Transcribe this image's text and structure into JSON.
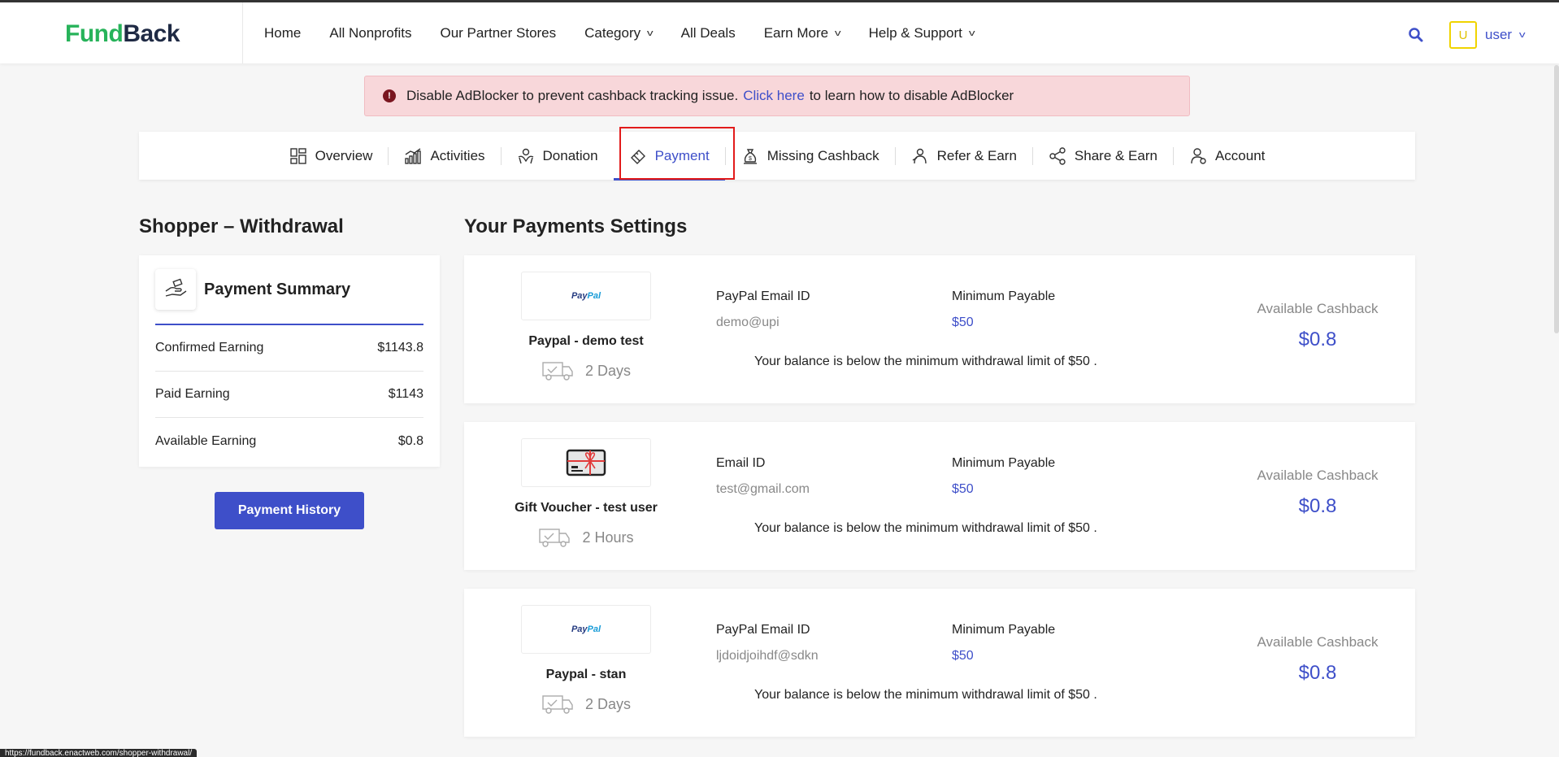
{
  "header": {
    "logo_part1": "Fund",
    "logo_part2": "Back",
    "nav": [
      {
        "label": "Home",
        "dropdown": false
      },
      {
        "label": "All Nonprofits",
        "dropdown": false
      },
      {
        "label": "Our Partner Stores",
        "dropdown": false
      },
      {
        "label": "Category",
        "dropdown": true
      },
      {
        "label": "All Deals",
        "dropdown": false
      },
      {
        "label": "Earn More",
        "dropdown": true
      },
      {
        "label": "Help & Support",
        "dropdown": true
      }
    ],
    "avatar_initial": "U",
    "user_label": "user"
  },
  "alert": {
    "text_before": "Disable AdBlocker to prevent cashback tracking issue.",
    "link": "Click here",
    "text_after": "to learn how to disable AdBlocker"
  },
  "tabs": [
    {
      "label": "Overview",
      "icon": "grid-icon"
    },
    {
      "label": "Activities",
      "icon": "chart-icon"
    },
    {
      "label": "Donation",
      "icon": "donation-hands-icon"
    },
    {
      "label": "Payment",
      "icon": "payment-card-icon",
      "active": true
    },
    {
      "label": "Missing Cashback",
      "icon": "money-bag-icon"
    },
    {
      "label": "Refer & Earn",
      "icon": "refer-person-icon"
    },
    {
      "label": "Share & Earn",
      "icon": "share-icon"
    },
    {
      "label": "Account",
      "icon": "account-icon"
    }
  ],
  "left": {
    "title": "Shopper – Withdrawal",
    "summary_title": "Payment Summary",
    "rows": [
      {
        "label": "Confirmed Earning",
        "value": "$1143.8"
      },
      {
        "label": "Paid Earning",
        "value": "$1143"
      },
      {
        "label": "Available Earning",
        "value": "$0.8"
      }
    ],
    "history_button": "Payment History"
  },
  "right": {
    "title": "Your Payments Settings",
    "cards": [
      {
        "logo": "paypal",
        "logo_text_1": "Pay",
        "logo_text_2": "Pal",
        "name": "Paypal - demo test",
        "delivery": "2 Days",
        "email_label": "PayPal Email ID",
        "email_value": "demo@upi",
        "min_label": "Minimum Payable",
        "min_value": "$50",
        "message": "Your balance is below the minimum withdrawal limit of $50 .",
        "avail_label": "Available Cashback",
        "avail_value": "$0.8"
      },
      {
        "logo": "gift-card",
        "name": "Gift Voucher - test user",
        "delivery": "2 Hours",
        "email_label": "Email ID",
        "email_value": "test@gmail.com",
        "min_label": "Minimum Payable",
        "min_value": "$50",
        "message": "Your balance is below the minimum withdrawal limit of $50 .",
        "avail_label": "Available Cashback",
        "avail_value": "$0.8"
      },
      {
        "logo": "paypal",
        "logo_text_1": "Pay",
        "logo_text_2": "Pal",
        "name": "Paypal - stan",
        "delivery": "2 Days",
        "email_label": "PayPal Email ID",
        "email_value": "ljdoidjoihdf@sdkn",
        "min_label": "Minimum Payable",
        "min_value": "$50",
        "message": "Your balance is below the minimum withdrawal limit of $50 .",
        "avail_label": "Available Cashback",
        "avail_value": "$0.8"
      }
    ]
  },
  "status_url": "https://fundback.enactweb.com/shopper-withdrawal/",
  "colors": {
    "accent": "#3e4fc9",
    "logo_green": "#27b35a",
    "alert_bg": "#f8d7da",
    "highlight": "#e21b1b"
  }
}
